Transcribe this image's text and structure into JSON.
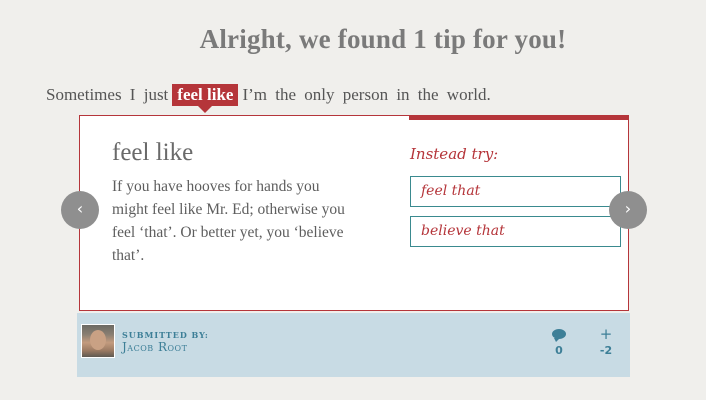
{
  "headline": "Alright, we found 1 tip for you!",
  "sentence": {
    "before": "Sometimes I just",
    "highlight": "feel like",
    "after": "I’m the only person in the world."
  },
  "tip": {
    "title": "feel like",
    "body": "If you have hooves for hands you might feel like Mr. Ed; otherwise you feel ‘that’. Or better yet, you ‘believe that’.",
    "instead_label": "Instead try:",
    "suggestions": [
      "feel that",
      "believe that"
    ]
  },
  "nav": {
    "prev_icon": "‹",
    "next_icon": "›"
  },
  "footer": {
    "submitted_by_label": "Submitted by:",
    "author": "Jacob Root",
    "comments_count": "0",
    "votes_icon": "+",
    "votes_count": "-2"
  },
  "colors": {
    "accent_red": "#b5353a",
    "teal": "#3d7f97",
    "footer_bg": "#c8dbe4"
  }
}
